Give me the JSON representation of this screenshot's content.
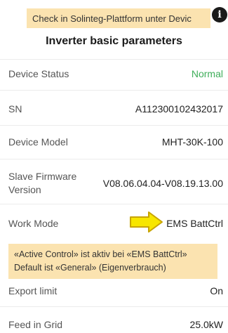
{
  "banner_top": "Check in Solinteg-Plattform unter Devic",
  "info_icon": "info-icon",
  "title": "Inverter basic parameters",
  "rows": [
    {
      "label": "Device Status",
      "value": "Normal",
      "value_color": "#3fae5a"
    },
    {
      "label": "SN",
      "value": "A112300102432017"
    },
    {
      "label": "Device Model",
      "value": "MHT-30K-100"
    },
    {
      "label_line1": "Slave Firmware",
      "label_line2": "Version",
      "value": "V08.06.04.04-V08.19.13.00"
    },
    {
      "label": "Work Mode",
      "value": "EMS BattCtrl"
    },
    {
      "label": "Export limit",
      "value": "On"
    },
    {
      "label": "Feed in Grid",
      "value": "25.0kW"
    }
  ],
  "note": {
    "line1": "«Active Control» ist aktiv bei «EMS BattCtrl»",
    "line2": "Default ist «General» (Eigenverbrauch)"
  },
  "colors": {
    "highlight": "#fbe3b0",
    "arrow_fill": "#f7e600",
    "arrow_stroke": "#c8a400",
    "status_green": "#3fae5a"
  }
}
